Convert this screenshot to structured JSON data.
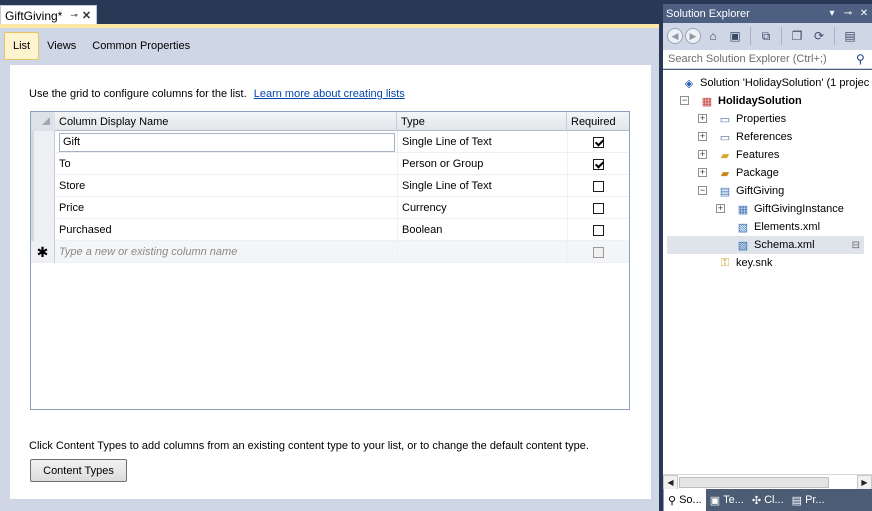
{
  "document_tab": {
    "title": "GiftGiving*",
    "pin_icon": "⊸",
    "close_icon": "✕"
  },
  "subtabs": [
    {
      "label": "List",
      "active": true
    },
    {
      "label": "Views",
      "active": false
    },
    {
      "label": "Common Properties",
      "active": false
    }
  ],
  "panel": {
    "intro_text": "Use the grid to configure columns for the list.",
    "learn_more_link": "Learn more about creating lists",
    "footer_text": "Click Content Types to add columns from an existing content type to your list, or to change the default content type.",
    "content_types_button": "Content Types"
  },
  "grid": {
    "headers": {
      "name": "Column Display Name",
      "type": "Type",
      "required": "Required"
    },
    "rows": [
      {
        "name": "Gift",
        "type": "Single Line of Text",
        "required": true
      },
      {
        "name": "To",
        "type": "Person or Group",
        "required": true
      },
      {
        "name": "Store",
        "type": "Single Line of Text",
        "required": false
      },
      {
        "name": "Price",
        "type": "Currency",
        "required": false
      },
      {
        "name": "Purchased",
        "type": "Boolean",
        "required": false
      }
    ],
    "new_row": {
      "marker": "✱",
      "placeholder": "Type a new or existing column name"
    }
  },
  "solution_explorer": {
    "title": "Solution Explorer",
    "title_buttons": [
      "▾",
      "⊸",
      "✕"
    ],
    "search_placeholder": "Search Solution Explorer (Ctrl+;)",
    "tree": {
      "solution": "Solution 'HolidaySolution' (1 projec",
      "project": "HolidaySolution",
      "properties": "Properties",
      "references": "References",
      "features": "Features",
      "package": "Package",
      "giftgiving": "GiftGiving",
      "instance": "GiftGivingInstance",
      "elements": "Elements.xml",
      "schema": "Schema.xml",
      "key": "key.snk"
    },
    "bottom_tabs": [
      {
        "label": "So...",
        "icon": "search-icon",
        "active": true
      },
      {
        "label": "Te...",
        "icon": "team-icon",
        "active": false
      },
      {
        "label": "Cl...",
        "icon": "class-icon",
        "active": false
      },
      {
        "label": "Pr...",
        "icon": "properties-icon",
        "active": false
      }
    ]
  },
  "colors": {
    "ide_background": "#293955",
    "tab_highlight": "#ffe8a6",
    "link": "#0645ad"
  }
}
